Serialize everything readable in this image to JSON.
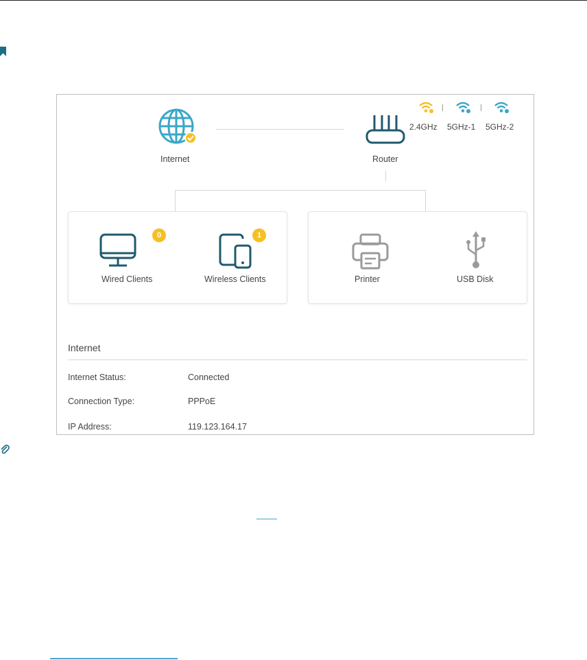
{
  "network_map": {
    "internet_label": "Internet",
    "router_label": "Router",
    "bands": [
      {
        "label": "2.4GHz",
        "color": "#f6c022"
      },
      {
        "label": "5GHz-1",
        "color": "#3aa7c8"
      },
      {
        "label": "5GHz-2",
        "color": "#3aa7c8"
      }
    ],
    "clients": {
      "wired_label": "Wired Clients",
      "wired_count": "0",
      "wireless_label": "Wireless Clients",
      "wireless_count": "1"
    },
    "devices": {
      "printer_label": "Printer",
      "usb_label": "USB Disk"
    }
  },
  "internet_section": {
    "title": "Internet",
    "rows": [
      {
        "key": "Internet Status:",
        "value": "Connected"
      },
      {
        "key": "Connection Type:",
        "value": "PPPoE"
      },
      {
        "key": "IP Address:",
        "value": "119.123.164.17"
      }
    ]
  },
  "colors": {
    "accent": "#3aa7c8",
    "dark_teal": "#1e5a6e",
    "badge": "#f6c022",
    "gray_icon": "#9a9a9a"
  }
}
